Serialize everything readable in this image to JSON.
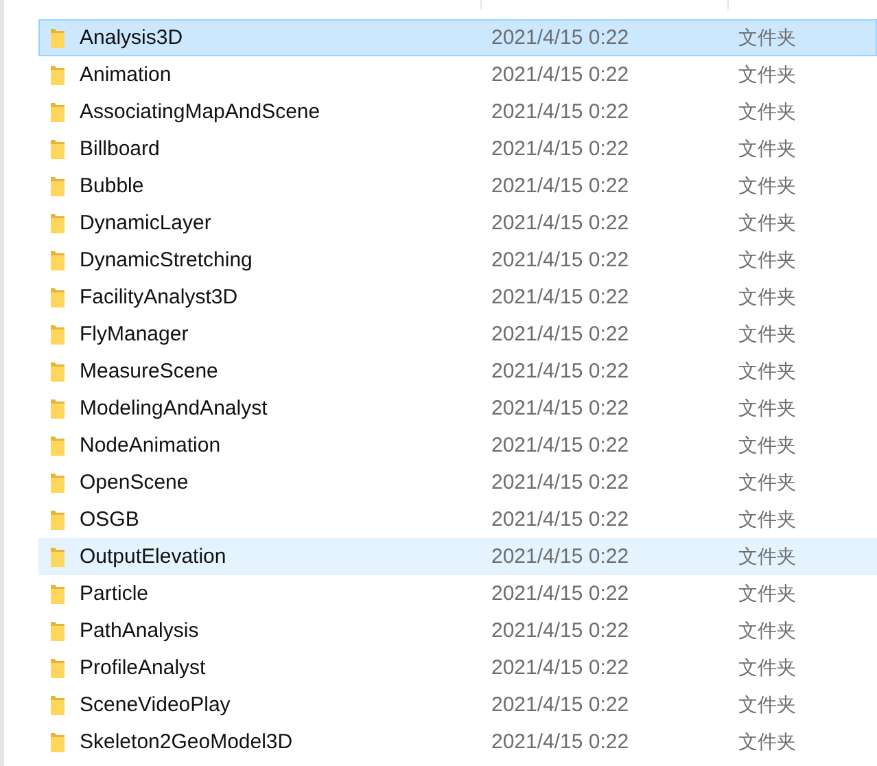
{
  "rows": [
    {
      "name": "Analysis3D",
      "modified": "2021/4/15 0:22",
      "type": "文件夹",
      "selected": true,
      "hovered": false
    },
    {
      "name": "Animation",
      "modified": "2021/4/15 0:22",
      "type": "文件夹",
      "selected": false,
      "hovered": false
    },
    {
      "name": "AssociatingMapAndScene",
      "modified": "2021/4/15 0:22",
      "type": "文件夹",
      "selected": false,
      "hovered": false
    },
    {
      "name": "Billboard",
      "modified": "2021/4/15 0:22",
      "type": "文件夹",
      "selected": false,
      "hovered": false
    },
    {
      "name": "Bubble",
      "modified": "2021/4/15 0:22",
      "type": "文件夹",
      "selected": false,
      "hovered": false
    },
    {
      "name": "DynamicLayer",
      "modified": "2021/4/15 0:22",
      "type": "文件夹",
      "selected": false,
      "hovered": false
    },
    {
      "name": "DynamicStretching",
      "modified": "2021/4/15 0:22",
      "type": "文件夹",
      "selected": false,
      "hovered": false
    },
    {
      "name": "FacilityAnalyst3D",
      "modified": "2021/4/15 0:22",
      "type": "文件夹",
      "selected": false,
      "hovered": false
    },
    {
      "name": "FlyManager",
      "modified": "2021/4/15 0:22",
      "type": "文件夹",
      "selected": false,
      "hovered": false
    },
    {
      "name": "MeasureScene",
      "modified": "2021/4/15 0:22",
      "type": "文件夹",
      "selected": false,
      "hovered": false
    },
    {
      "name": "ModelingAndAnalyst",
      "modified": "2021/4/15 0:22",
      "type": "文件夹",
      "selected": false,
      "hovered": false
    },
    {
      "name": "NodeAnimation",
      "modified": "2021/4/15 0:22",
      "type": "文件夹",
      "selected": false,
      "hovered": false
    },
    {
      "name": "OpenScene",
      "modified": "2021/4/15 0:22",
      "type": "文件夹",
      "selected": false,
      "hovered": false
    },
    {
      "name": "OSGB",
      "modified": "2021/4/15 0:22",
      "type": "文件夹",
      "selected": false,
      "hovered": false
    },
    {
      "name": "OutputElevation",
      "modified": "2021/4/15 0:22",
      "type": "文件夹",
      "selected": false,
      "hovered": true
    },
    {
      "name": "Particle",
      "modified": "2021/4/15 0:22",
      "type": "文件夹",
      "selected": false,
      "hovered": false
    },
    {
      "name": "PathAnalysis",
      "modified": "2021/4/15 0:22",
      "type": "文件夹",
      "selected": false,
      "hovered": false
    },
    {
      "name": "ProfileAnalyst",
      "modified": "2021/4/15 0:22",
      "type": "文件夹",
      "selected": false,
      "hovered": false
    },
    {
      "name": "SceneVideoPlay",
      "modified": "2021/4/15 0:22",
      "type": "文件夹",
      "selected": false,
      "hovered": false
    },
    {
      "name": "Skeleton2GeoModel3D",
      "modified": "2021/4/15 0:22",
      "type": "文件夹",
      "selected": false,
      "hovered": false
    }
  ]
}
